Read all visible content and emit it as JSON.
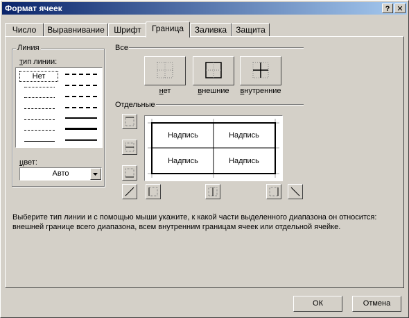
{
  "window": {
    "title": "Формат ячеек",
    "help_label": "?",
    "close_label": "✕"
  },
  "tabs": [
    {
      "label": "Число"
    },
    {
      "label": "Выравнивание"
    },
    {
      "label": "Шрифт"
    },
    {
      "label": "Граница"
    },
    {
      "label": "Заливка"
    },
    {
      "label": "Защита"
    }
  ],
  "active_tab": "Граница",
  "line": {
    "group_title": "Линия",
    "type_label": "тип линии:",
    "none_label": "Нет",
    "color_label": "цвет:",
    "color_value": "Авто"
  },
  "all": {
    "group_title": "Все",
    "presets": [
      {
        "label": "нет"
      },
      {
        "label": "внешние"
      },
      {
        "label": "внутренние"
      }
    ]
  },
  "separate": {
    "group_title": "Отдельные",
    "cells": [
      "Надпись",
      "Надпись",
      "Надпись",
      "Надпись"
    ]
  },
  "hint": "Выберите тип линии и с помощью мыши укажите, к какой части выделенного диапазона он относится: внешней границе всего диапазона, всем внутренним границам ячеек или отдельной ячейке.",
  "buttons": {
    "ok": "ОК",
    "cancel": "Отмена"
  }
}
